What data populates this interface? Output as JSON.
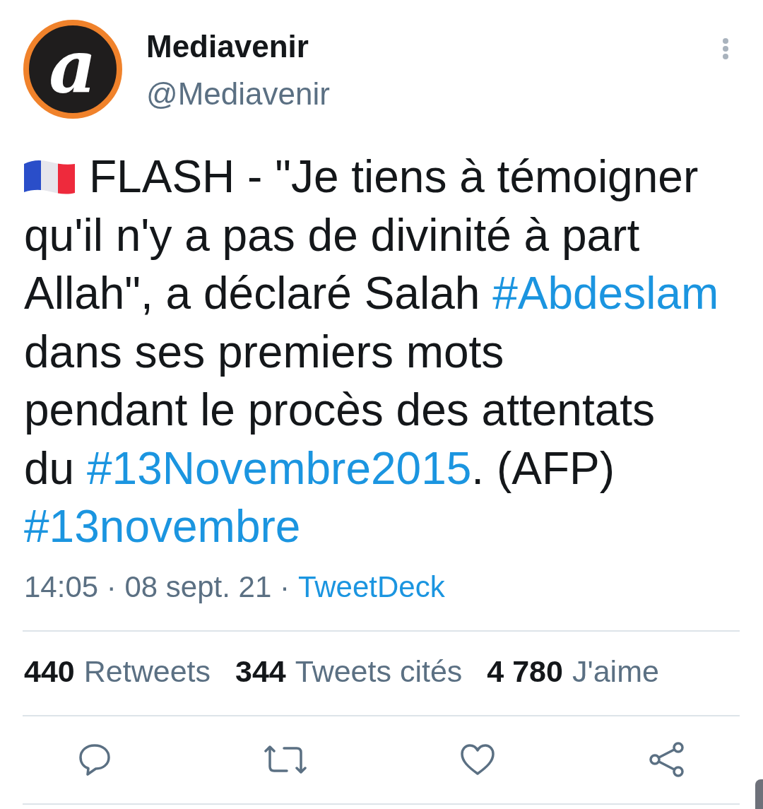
{
  "author": {
    "avatar_letter": "a",
    "name": "Mediavenir",
    "handle": "@Mediavenir"
  },
  "tweet": {
    "segments": [
      {
        "kind": "text",
        "text": "FLASH - \"Je tiens à témoigner\nqu'il n'y a pas de divinité à part\nAllah\", a déclaré Salah "
      },
      {
        "kind": "hashtag",
        "text": "#Abdeslam"
      },
      {
        "kind": "text",
        "text": "\ndans ses premiers mots\npendant le procès des attentats\ndu "
      },
      {
        "kind": "hashtag",
        "text": "#13Novembre2015"
      },
      {
        "kind": "text",
        "text": ". (AFP)\n"
      },
      {
        "kind": "hashtag",
        "text": "#13novembre"
      }
    ]
  },
  "meta": {
    "timestamp": "14:05 · 08 sept. 21 ·",
    "source": "TweetDeck"
  },
  "stats": [
    {
      "count": "440",
      "label": "Retweets"
    },
    {
      "count": "344",
      "label": "Tweets cités"
    },
    {
      "count": "4 780",
      "label": "J'aime"
    }
  ]
}
